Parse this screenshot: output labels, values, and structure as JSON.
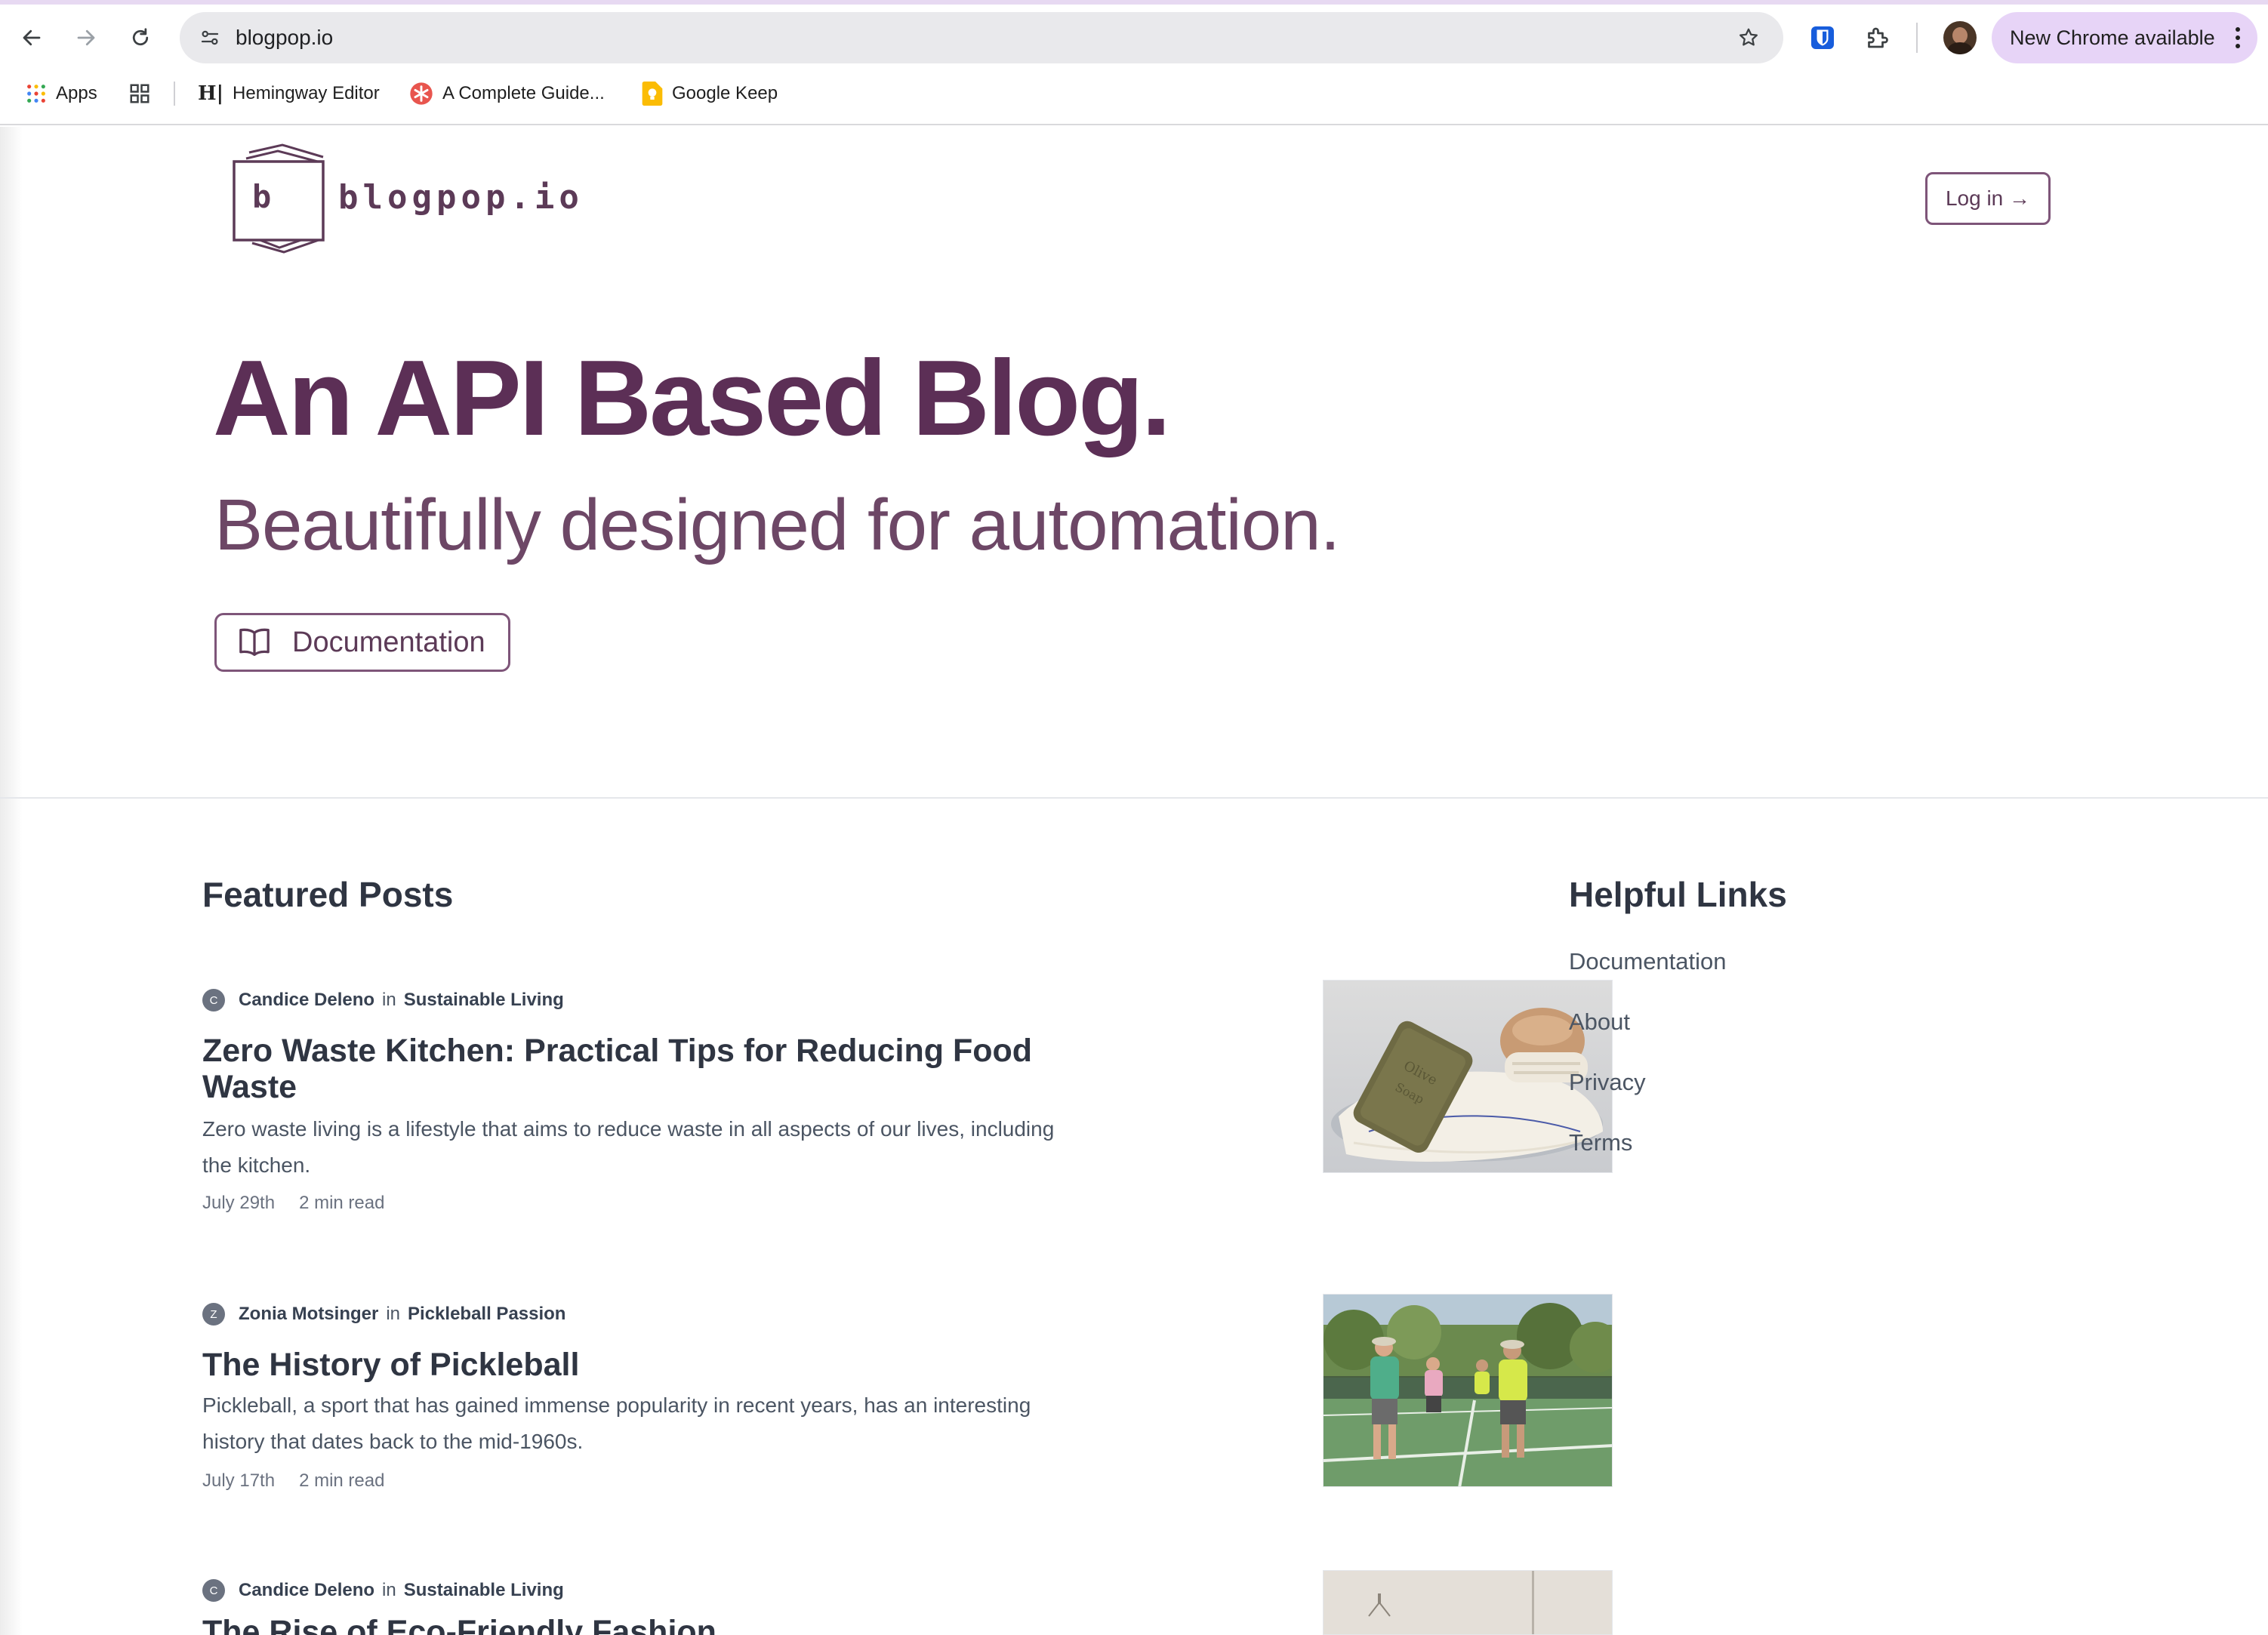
{
  "browser": {
    "url": "blogpop.io",
    "update_label": "New Chrome available",
    "bookmarks": [
      {
        "label": "Apps",
        "icon": "apps-grid-icon"
      },
      {
        "label": "",
        "icon": "grid-icon"
      },
      {
        "label": "Hemingway Editor",
        "icon": "hemingway-icon"
      },
      {
        "label": "A Complete Guide...",
        "icon": "asterisk-icon"
      },
      {
        "label": "Google Keep",
        "icon": "keep-icon"
      }
    ]
  },
  "site": {
    "logo_letter": "b",
    "name": "blogpop.io",
    "login_label": "Log in →",
    "hero_title": "An API Based Blog.",
    "hero_subtitle": "Beautifully designed for automation.",
    "docs_button": "Documentation",
    "brand_color": "#5c2f56"
  },
  "featured": {
    "heading": "Featured Posts",
    "posts": [
      {
        "initial": "C",
        "author": "Candice Deleno",
        "in": "in",
        "category": "Sustainable Living",
        "title": "Zero Waste Kitchen: Practical Tips for Reducing Food Waste",
        "excerpt": "Zero waste living is a lifestyle that aims to reduce waste in all aspects of our lives, including the kitchen.",
        "date": "July 29th",
        "read_time": "2 min read",
        "image": "olive-soap-and-brush-photo"
      },
      {
        "initial": "Z",
        "author": "Zonia Motsinger",
        "in": "in",
        "category": "Pickleball Passion",
        "title": "The History of Pickleball",
        "excerpt": "Pickleball, a sport that has gained immense popularity in recent years, has an interesting history that dates back to the mid-1960s.",
        "date": "July 17th",
        "read_time": "2 min read",
        "image": "pickleball-players-photo"
      },
      {
        "initial": "C",
        "author": "Candice Deleno",
        "in": "in",
        "category": "Sustainable Living",
        "title": "The Rise of Eco-Friendly Fashion",
        "image": "clothing-rack-photo"
      }
    ]
  },
  "helpful": {
    "heading": "Helpful Links",
    "links": [
      "Documentation",
      "About",
      "Privacy",
      "Terms"
    ]
  }
}
